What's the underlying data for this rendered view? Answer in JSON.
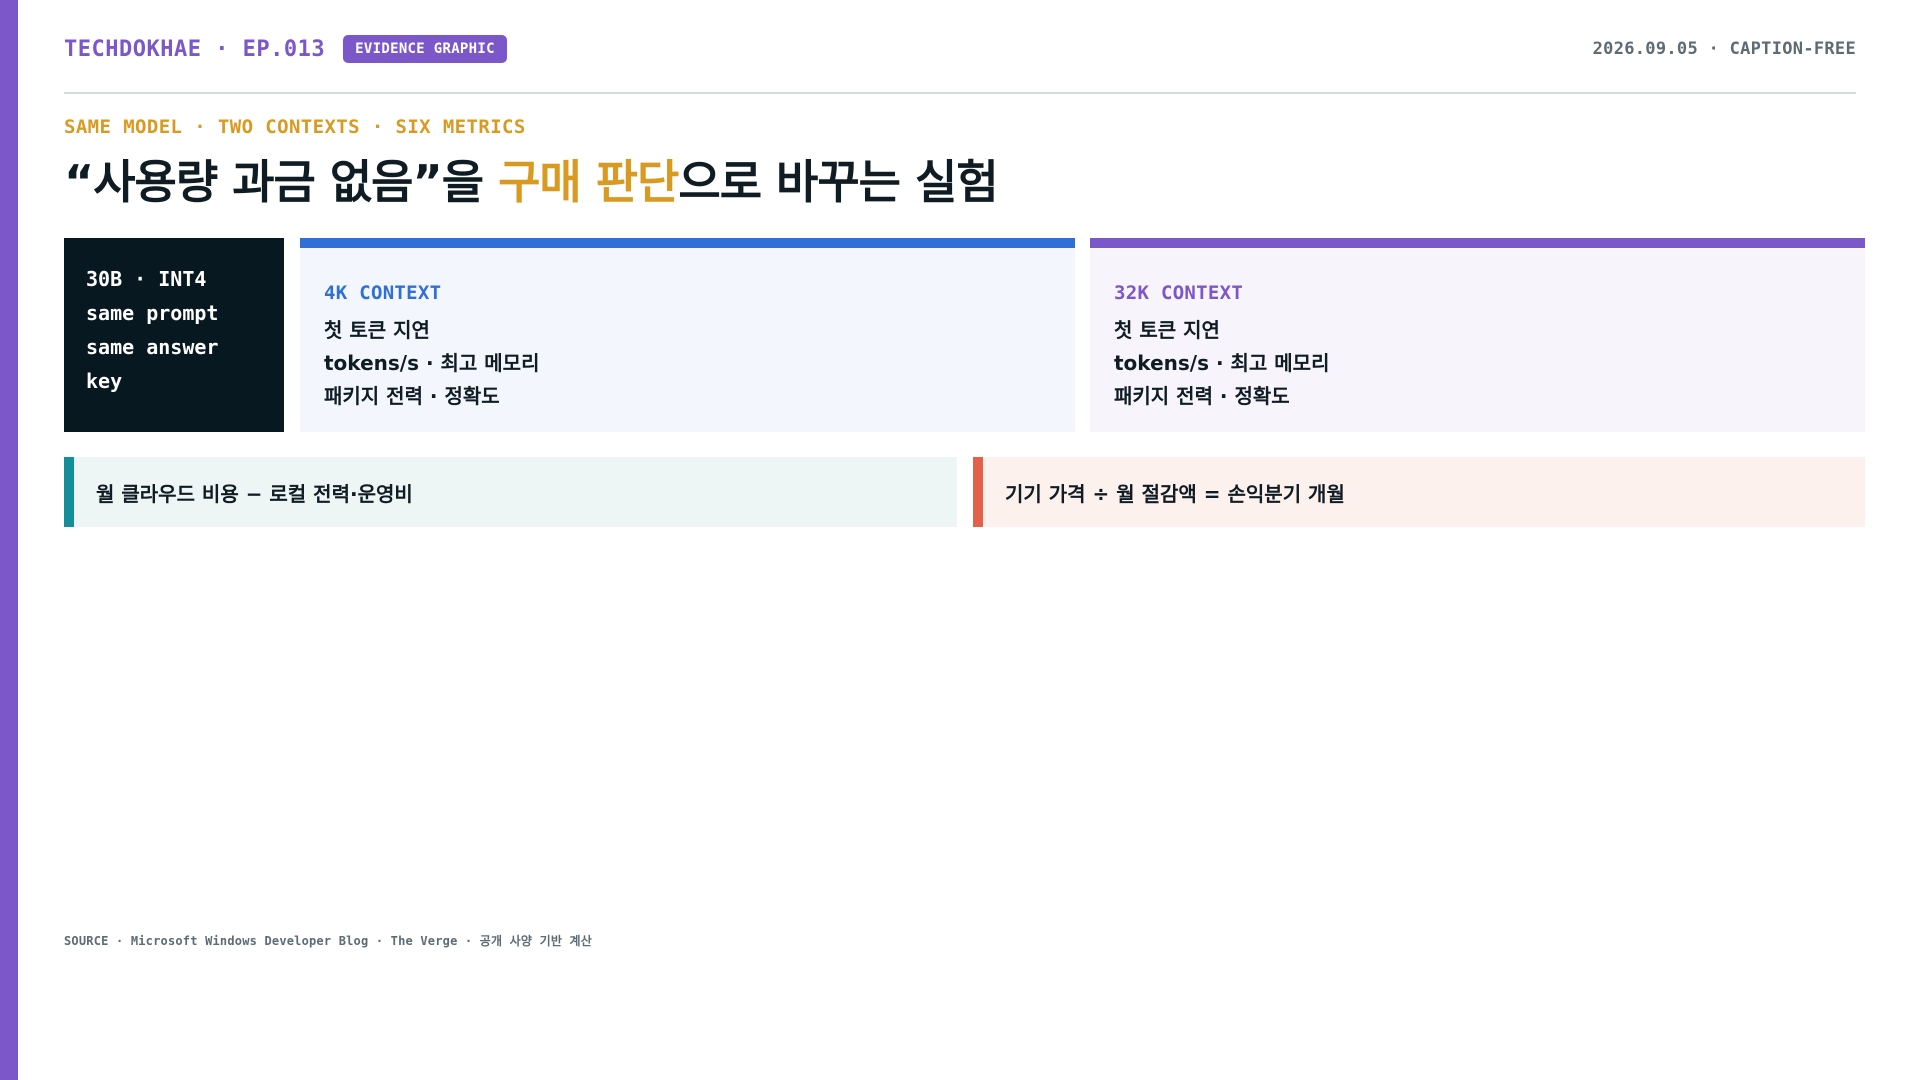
{
  "header": {
    "brand": "TECHDOKHAE · EP.013",
    "badge": "EVIDENCE GRAPHIC",
    "meta": "2026.09.05 · CAPTION-FREE"
  },
  "kicker": "SAME MODEL · TWO CONTEXTS · SIX METRICS",
  "headline": {
    "part1": "“사용량 과금 없음”을 ",
    "highlight": "구매 판단",
    "part2": "으로 바꾸는 실험"
  },
  "spec": {
    "lines": [
      "30B · INT4",
      "same prompt",
      "same answer",
      "key"
    ]
  },
  "contexts": [
    {
      "title": "4K CONTEXT",
      "lines": [
        "첫 토큰 지연",
        "tokens/s · 최고 메모리",
        "패키지 전력 · 정확도"
      ]
    },
    {
      "title": "32K CONTEXT",
      "lines": [
        "첫 토큰 지연",
        "tokens/s · 최고 메모리",
        "패키지 전력 · 정확도"
      ]
    }
  ],
  "formulas": {
    "left": "월 클라우드 비용 − 로컬 전력·운영비",
    "right": "기기 가격 ÷ 월 절감액 = 손익분기 개월"
  },
  "source": "SOURCE · Microsoft Windows Developer Blog · The Verge · 공개 사양 기반 계산",
  "colors": {
    "accent_purple": "#7b57c9",
    "accent_gold": "#d99a22",
    "accent_blue": "#2f6fd6",
    "accent_teal": "#138f99",
    "accent_coral": "#e3604a",
    "dark_card": "#081821"
  }
}
